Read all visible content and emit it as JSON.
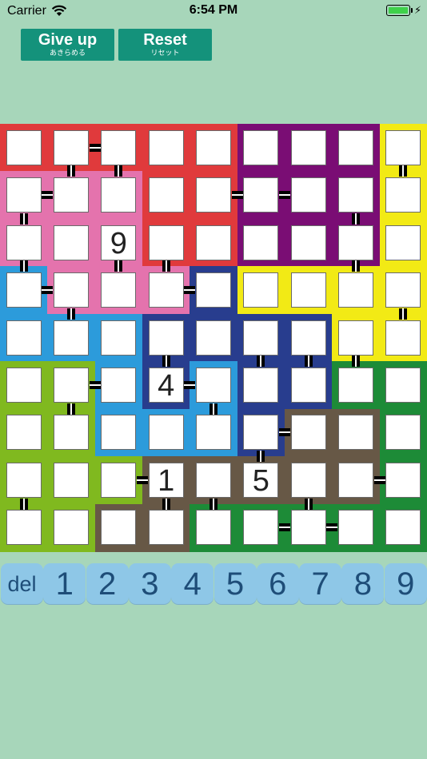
{
  "status_bar": {
    "carrier": "Carrier",
    "time": "6:54 PM"
  },
  "buttons": {
    "give_up": {
      "label": "Give up",
      "sublabel": "あきらめる"
    },
    "reset": {
      "label": "Reset",
      "sublabel": "リセット"
    }
  },
  "colors": {
    "background": "#a7d6ba",
    "red": "#e03a3c",
    "purple": "#7a0d74",
    "yellow": "#f2ea15",
    "pink": "#e473ad",
    "blue": "#2c9bdb",
    "navy": "#283d8e",
    "lime": "#80b91f",
    "brown": "#675846",
    "green": "#1d8b37",
    "button": "#14927b",
    "key": "#8ec7e7"
  },
  "board": {
    "rows": 9,
    "cols": 9,
    "region_colors": [
      [
        "red",
        "red",
        "red",
        "red",
        "red",
        "purple",
        "purple",
        "purple",
        "yellow"
      ],
      [
        "pink",
        "pink",
        "pink",
        "red",
        "red",
        "purple",
        "purple",
        "purple",
        "yellow"
      ],
      [
        "pink",
        "pink",
        "pink",
        "red",
        "red",
        "purple",
        "purple",
        "purple",
        "yellow"
      ],
      [
        "blue",
        "pink",
        "pink",
        "pink",
        "navy",
        "yellow",
        "yellow",
        "yellow",
        "yellow"
      ],
      [
        "blue",
        "blue",
        "blue",
        "navy",
        "navy",
        "navy",
        "navy",
        "yellow",
        "yellow"
      ],
      [
        "lime",
        "lime",
        "blue",
        "navy",
        "blue",
        "navy",
        "navy",
        "green",
        "green"
      ],
      [
        "lime",
        "lime",
        "blue",
        "blue",
        "blue",
        "navy",
        "brown",
        "brown",
        "green"
      ],
      [
        "lime",
        "lime",
        "lime",
        "brown",
        "brown",
        "brown",
        "brown",
        "brown",
        "green"
      ],
      [
        "lime",
        "lime",
        "brown",
        "brown",
        "green",
        "green",
        "green",
        "green",
        "green"
      ]
    ],
    "values": [
      [
        "",
        "",
        "",
        "",
        "",
        "",
        "",
        "",
        ""
      ],
      [
        "",
        "",
        "",
        "",
        "",
        "",
        "",
        "",
        ""
      ],
      [
        "",
        "",
        "9",
        "",
        "",
        "",
        "",
        "",
        ""
      ],
      [
        "",
        "",
        "",
        "",
        "",
        "",
        "",
        "",
        ""
      ],
      [
        "",
        "",
        "",
        "",
        "",
        "",
        "",
        "",
        ""
      ],
      [
        "",
        "",
        "",
        "4",
        "",
        "",
        "",
        "",
        ""
      ],
      [
        "",
        "",
        "",
        "",
        "",
        "",
        "",
        "",
        ""
      ],
      [
        "",
        "",
        "",
        "1",
        "",
        "5",
        "",
        "",
        ""
      ],
      [
        "",
        "",
        "",
        "",
        "",
        "",
        "",
        "",
        ""
      ]
    ],
    "h_connectors": [
      [
        0,
        1
      ],
      [
        1,
        0
      ],
      [
        1,
        4
      ],
      [
        1,
        5
      ],
      [
        3,
        0
      ],
      [
        3,
        3
      ],
      [
        5,
        1
      ],
      [
        5,
        3
      ],
      [
        6,
        5
      ],
      [
        7,
        2
      ],
      [
        7,
        7
      ],
      [
        8,
        5
      ],
      [
        8,
        6
      ]
    ],
    "v_connectors": [
      [
        0,
        1
      ],
      [
        0,
        2
      ],
      [
        0,
        8
      ],
      [
        1,
        0
      ],
      [
        1,
        7
      ],
      [
        2,
        0
      ],
      [
        2,
        2
      ],
      [
        2,
        3
      ],
      [
        2,
        7
      ],
      [
        3,
        1
      ],
      [
        3,
        8
      ],
      [
        4,
        3
      ],
      [
        4,
        5
      ],
      [
        4,
        6
      ],
      [
        4,
        7
      ],
      [
        5,
        4
      ],
      [
        5,
        1
      ],
      [
        6,
        5
      ],
      [
        7,
        0
      ],
      [
        7,
        3
      ],
      [
        7,
        4
      ],
      [
        7,
        6
      ]
    ]
  },
  "numpad": [
    "del",
    "1",
    "2",
    "3",
    "4",
    "5",
    "6",
    "7",
    "8",
    "9"
  ]
}
